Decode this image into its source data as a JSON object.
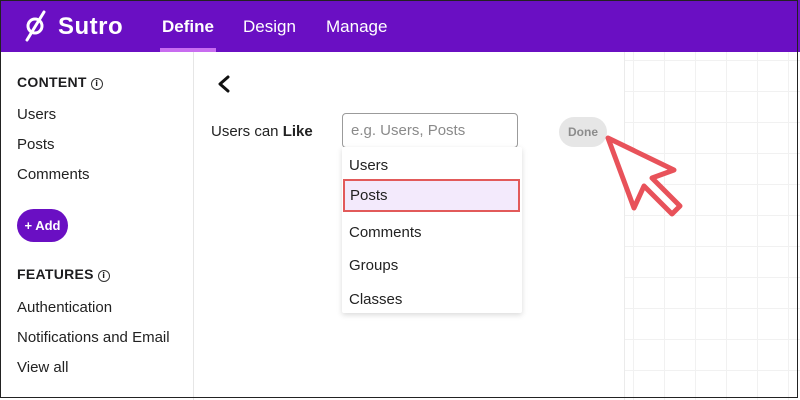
{
  "header": {
    "logo_text": "Sutro",
    "nav": [
      "Define",
      "Design",
      "Manage"
    ],
    "active_tab": "Define",
    "background_color": "#6a0fc3"
  },
  "sidebar": {
    "content_title": "CONTENT",
    "content_items": [
      "Users",
      "Posts",
      "Comments"
    ],
    "add_label": "+ Add",
    "features_title": "FEATURES",
    "feature_items": [
      "Authentication",
      "Notifications and Email",
      "View all"
    ]
  },
  "main": {
    "prompt_prefix": "Users can ",
    "prompt_bold": "Like",
    "search_placeholder": "e.g. Users, Posts",
    "done_label": "Done",
    "dropdown_items": [
      "Users",
      "Posts",
      "Comments",
      "Groups",
      "Classes"
    ],
    "highlighted_item": "Posts"
  },
  "icons": {
    "logo": "sutro-logo-icon",
    "back": "chevron-left-icon",
    "info": "info-icon",
    "pointer": "cursor-arrow-icon"
  },
  "colors": {
    "accent": "#6a0fc3",
    "highlight_border": "#e25a5a",
    "highlight_fill": "#f3eafc"
  }
}
